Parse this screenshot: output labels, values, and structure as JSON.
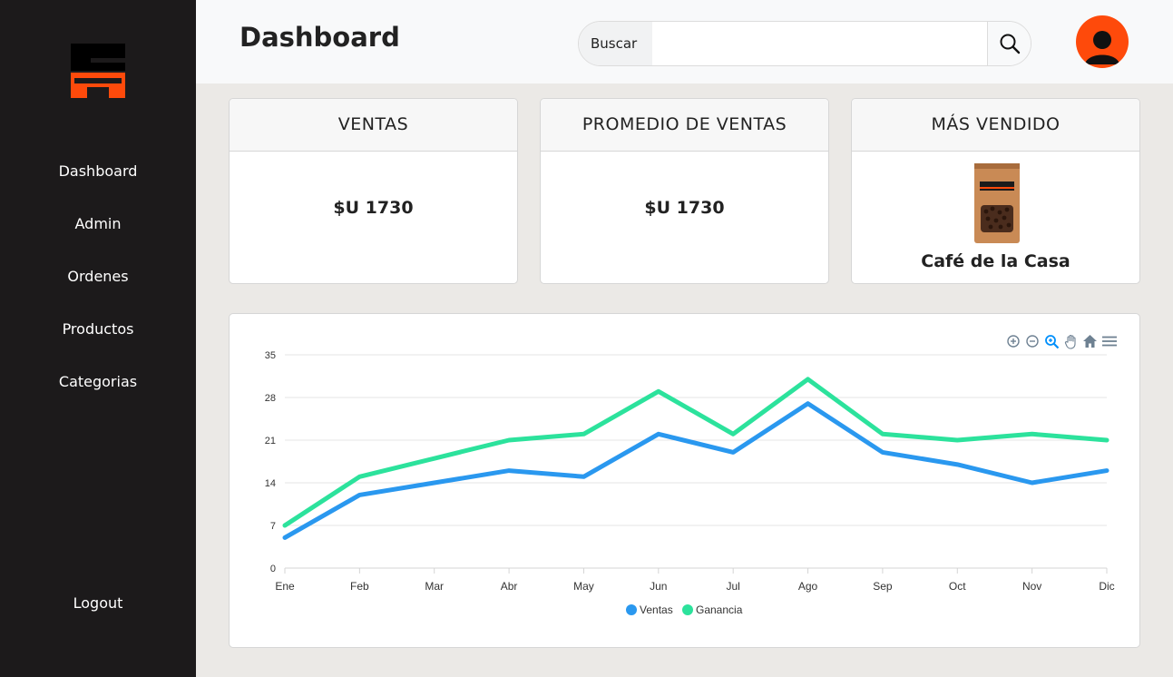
{
  "sidebar": {
    "items": [
      {
        "label": "Dashboard"
      },
      {
        "label": "Admin"
      },
      {
        "label": "Ordenes"
      },
      {
        "label": "Productos"
      },
      {
        "label": "Categorias"
      }
    ],
    "logout": "Logout"
  },
  "header": {
    "title": "Dashboard",
    "search_label": "Buscar",
    "search_placeholder": "",
    "search_value": ""
  },
  "cards": [
    {
      "title": "VENTAS",
      "value": "$U 1730"
    },
    {
      "title": "PROMEDIO DE VENTAS",
      "value": "$U 1730"
    },
    {
      "title": "MÁS VENDIDO",
      "product": "Café de la Casa"
    }
  ],
  "colors": {
    "brand": "#fe4a0b",
    "sidebar": "#1c1a1b",
    "ventas": "#2a98ef",
    "ganancia": "#2ce29c"
  },
  "chart_toolbar": [
    "zoom-in-icon",
    "zoom-out-icon",
    "selection-zoom-icon",
    "pan-icon",
    "reset-home-icon",
    "menu-icon"
  ],
  "chart_data": {
    "type": "line",
    "categories": [
      "Ene",
      "Feb",
      "Mar",
      "Abr",
      "May",
      "Jun",
      "Jul",
      "Ago",
      "Sep",
      "Oct",
      "Nov",
      "Dic"
    ],
    "series": [
      {
        "name": "Ventas",
        "values": [
          5,
          12,
          14,
          16,
          15,
          22,
          19,
          27,
          19,
          17,
          14,
          16
        ]
      },
      {
        "name": "Ganancia",
        "values": [
          7,
          15,
          18,
          21,
          22,
          29,
          22,
          31,
          22,
          21,
          22,
          21
        ]
      }
    ],
    "ylim": [
      0,
      35
    ],
    "yticks": [
      0,
      7,
      14,
      21,
      28,
      35
    ],
    "grid": true,
    "legend": "bottom-center"
  }
}
